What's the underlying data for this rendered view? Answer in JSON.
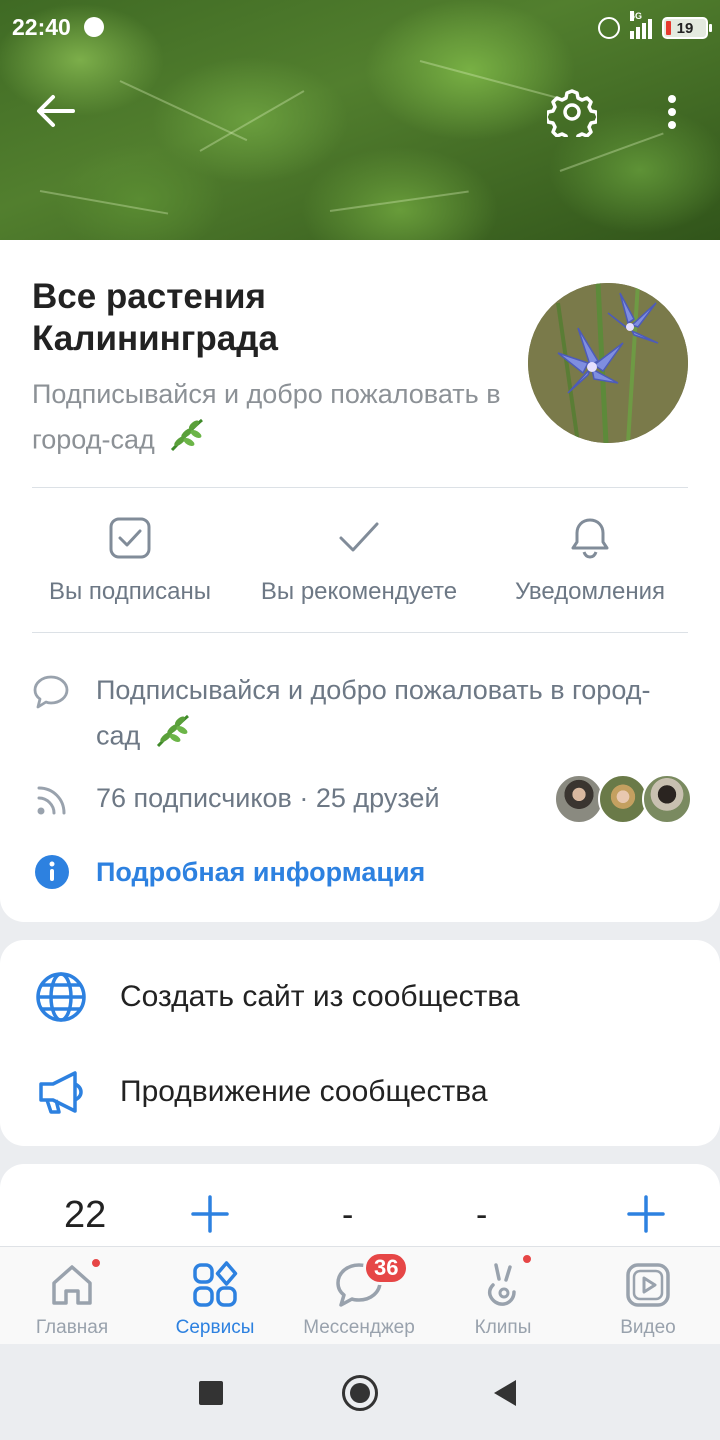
{
  "status_bar": {
    "time": "22:40",
    "network": "4G",
    "battery": "19"
  },
  "header": {
    "back_icon": "arrow-left-icon",
    "settings_icon": "gear-icon",
    "more_icon": "more-vertical-icon"
  },
  "community": {
    "name": "Все растения Калининграда",
    "status": "Подписывайся и добро пожаловать в город-сад",
    "status_emoji": "🌿"
  },
  "actions": [
    {
      "label": "Вы подписаны",
      "icon": "checkbox-icon"
    },
    {
      "label": "Вы рекомендуете",
      "icon": "check-icon"
    },
    {
      "label": "Уведомления",
      "icon": "bell-icon"
    }
  ],
  "info": {
    "description": "Подписывайся и добро пожаловать в город-сад",
    "followers": "76 подписчиков · 25 друзей",
    "details_link": "Подробная информация"
  },
  "services": [
    {
      "label": "Создать сайт из сообщества",
      "icon": "globe-icon"
    },
    {
      "label": "Продвижение сообщества",
      "icon": "megaphone-icon"
    }
  ],
  "stats": {
    "value_1": "22",
    "dash_1": "-",
    "dash_2": "-"
  },
  "tabbar": [
    {
      "label": "Главная",
      "icon": "home-icon",
      "active": false,
      "dot": true
    },
    {
      "label": "Сервисы",
      "icon": "services-icon",
      "active": true
    },
    {
      "label": "Мессенджер",
      "icon": "message-icon",
      "badge": "36"
    },
    {
      "label": "Клипы",
      "icon": "clips-icon",
      "dot": true
    },
    {
      "label": "Видео",
      "icon": "video-icon"
    }
  ],
  "colors": {
    "accent": "#2d81e0",
    "badge": "#e64646",
    "secondary_text": "#6d7885"
  }
}
